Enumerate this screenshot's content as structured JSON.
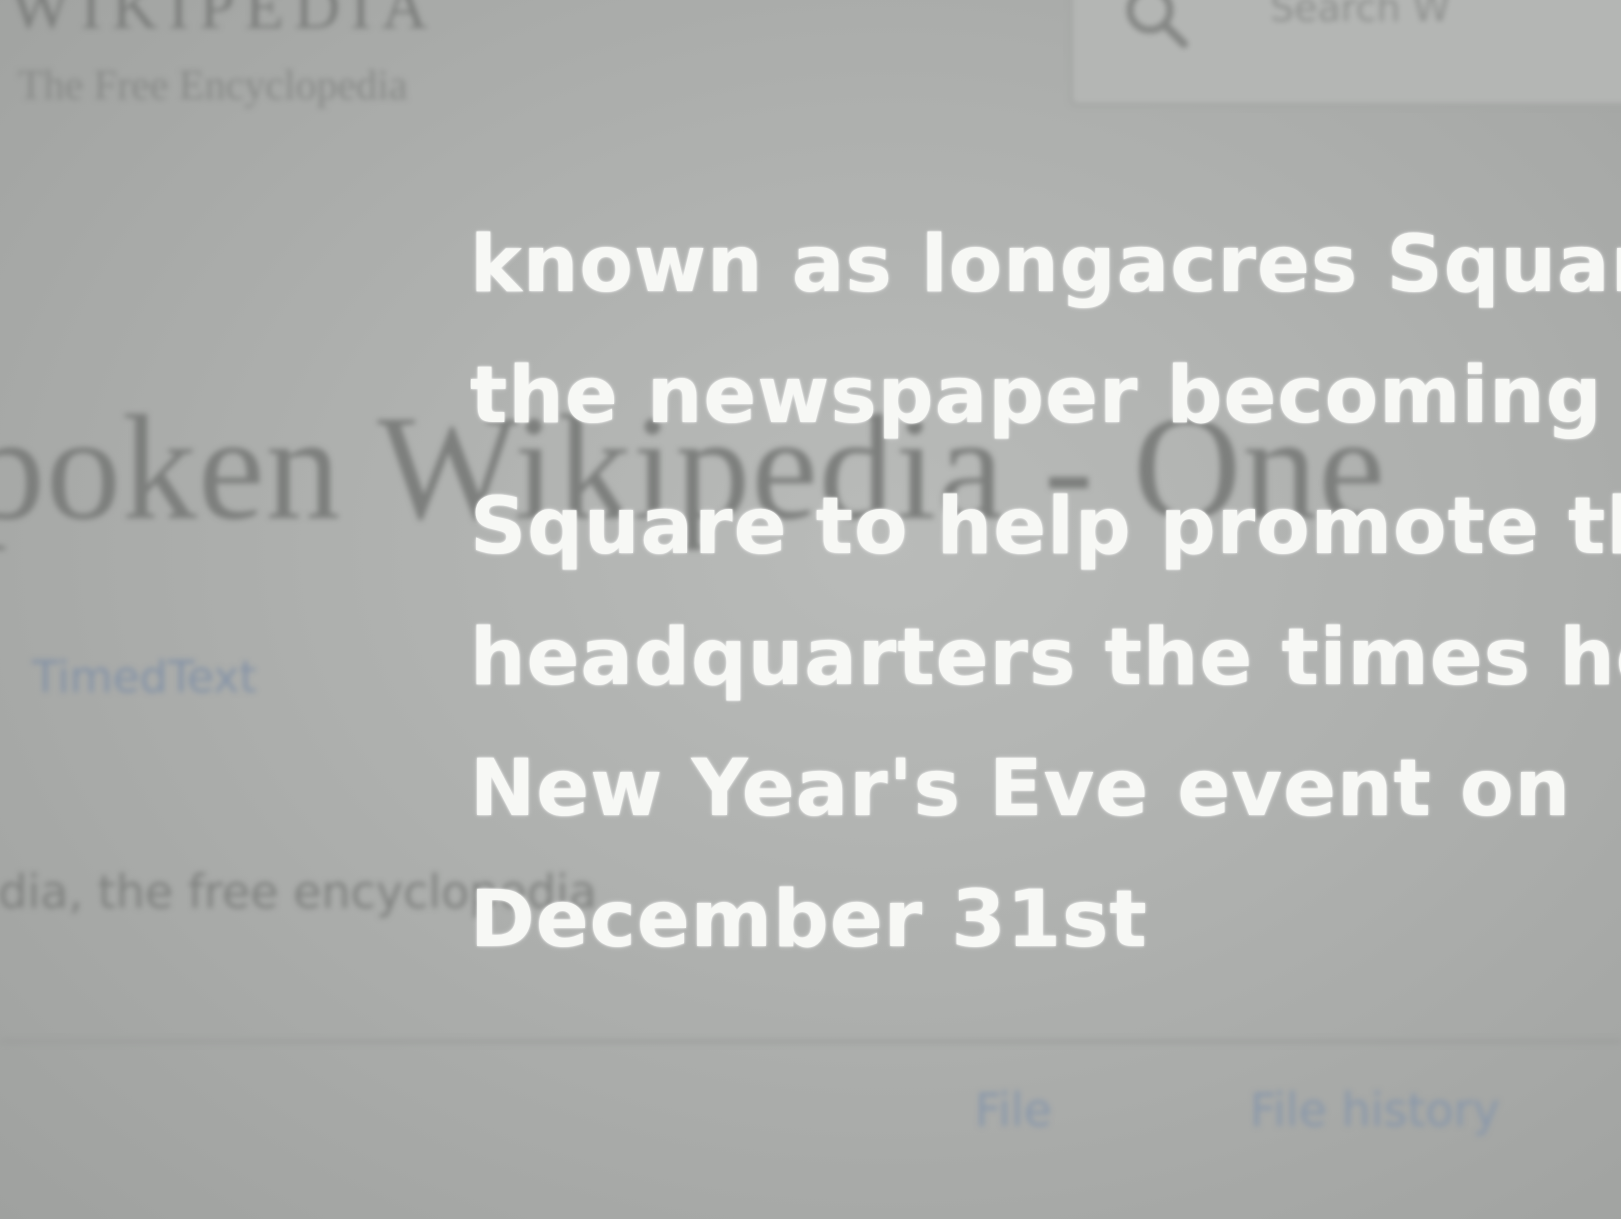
{
  "wikipedia": {
    "wordmark": "WIKIPEDIA",
    "tagline": "The Free Encyclopedia",
    "search_placeholder": "Search W"
  },
  "page": {
    "title": "poken Wikipedia - One",
    "timedtext_link": "TimedText",
    "from_line": "edia, the free encyclopedia"
  },
  "tabs": {
    "file": "File",
    "file_history": "File history"
  },
  "caption": {
    "lines": [
      "known as longacres Square",
      "the newspaper becoming Tin",
      "Square to help promote the",
      "headquarters the times held",
      "New Year's Eve event on",
      "December 31st"
    ]
  }
}
